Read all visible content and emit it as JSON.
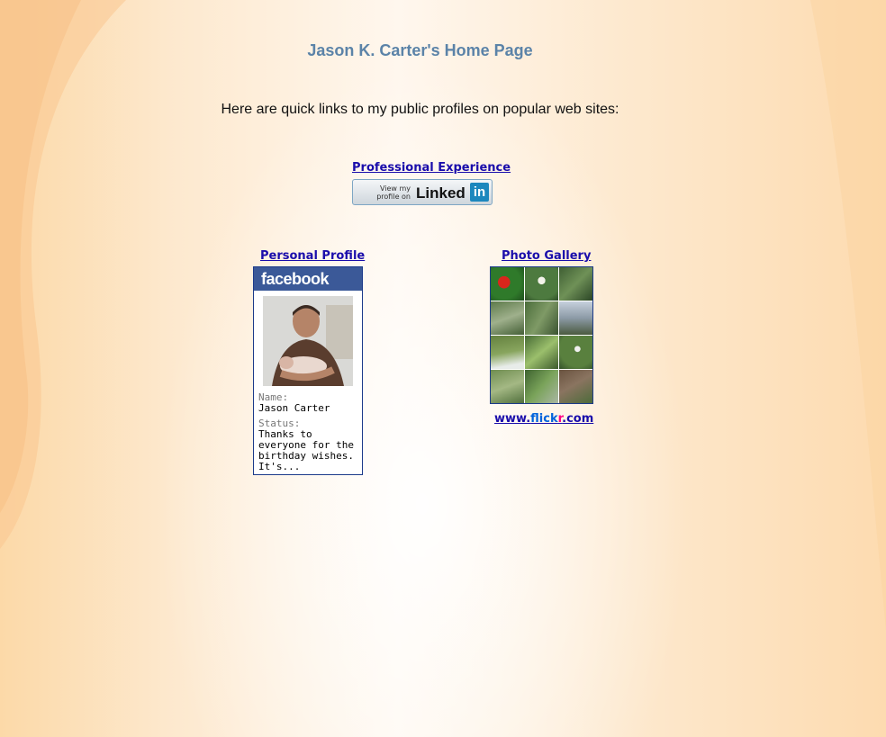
{
  "page": {
    "title": "Jason K. Carter's Home Page",
    "intro": "Here are quick links to my public profiles on popular web sites:"
  },
  "professional": {
    "link_text": "Professional Experience",
    "badge": {
      "line1": "View my",
      "line2": "profile on",
      "brand_word": "Linked",
      "brand_box": "in"
    }
  },
  "personal": {
    "link_text": "Personal Profile",
    "card": {
      "brand": "facebook",
      "name_label": "Name:",
      "name": "Jason Carter",
      "status_label": "Status:",
      "status_lines": [
        "Thanks to",
        "everyone for the",
        "birthday wishes.",
        "It's..."
      ]
    }
  },
  "gallery": {
    "link_text": "Photo Gallery",
    "thumb_count": 12,
    "site": {
      "prefix": "www.",
      "flick": "flick",
      "r": "r",
      "suffix": ".com"
    }
  },
  "colors": {
    "title": "#5b83a8",
    "link": "#1a0dab",
    "facebook_blue": "#3b5998",
    "linkedin_blue": "#1d87bd",
    "flickr_blue": "#0063dc",
    "flickr_pink": "#ff0084"
  }
}
